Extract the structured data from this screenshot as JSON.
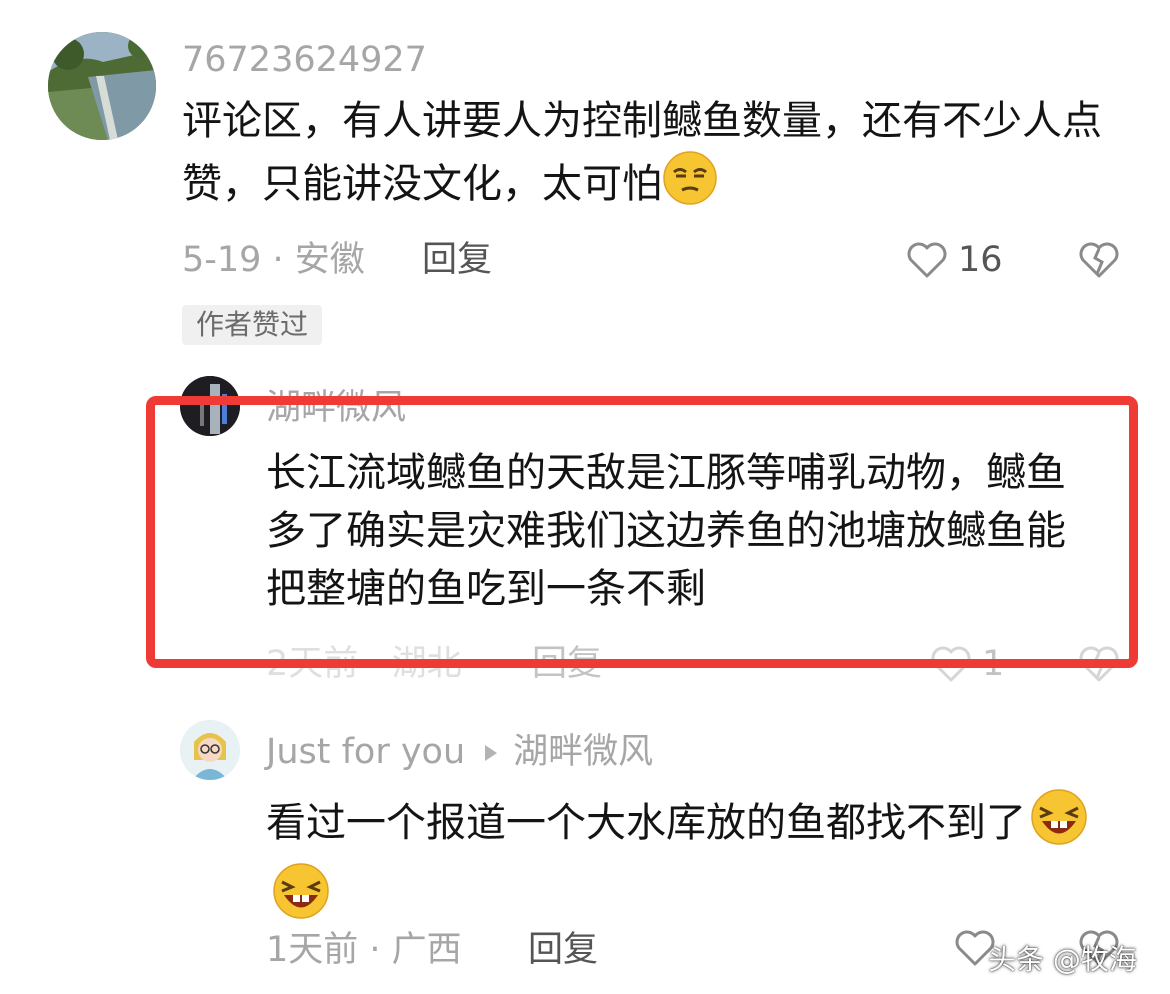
{
  "comments": [
    {
      "username": "76723624927",
      "text": "评论区，有人讲要人为控制鳡鱼数量，还有不少人点赞，只能讲没文化，太可怕",
      "date_location": "5-19 · 安徽",
      "reply_label": "回复",
      "like_count": "16",
      "author_tag": "作者赞过"
    },
    {
      "username": "湖畔微风",
      "text": "长江流域鳡鱼的天敌是江豚等哺乳动物，鳡鱼多了确实是灾难我们这边养鱼的池塘放鳡鱼能把整塘的鱼吃到一条不剩",
      "date_location": "2天前 · 湖北",
      "reply_label": "回复",
      "like_count": "1"
    },
    {
      "username": "Just for you",
      "reply_to": "湖畔微风",
      "text": "看过一个报道一个大水库放的鱼都找不到了",
      "date_location": "1天前 · 广西",
      "reply_label": "回复"
    }
  ],
  "watermark": "头条 @牧海",
  "colors": {
    "highlight_border": "#ef3b36",
    "meta_text": "#a6a6a6",
    "body_text": "#141414"
  },
  "icons": [
    "heart-outline-icon",
    "broken-heart-icon",
    "squint-emoji-icon",
    "laughing-emoji-icon",
    "triangle-right-icon"
  ]
}
